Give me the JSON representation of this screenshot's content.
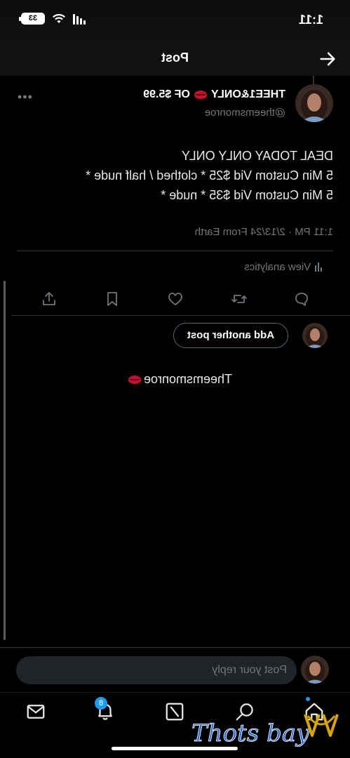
{
  "status": {
    "time": "1:11",
    "battery": "33"
  },
  "header": {
    "title": "Post"
  },
  "post": {
    "display_name": "THEE1&ONLY",
    "name_suffix": "OF $5.99",
    "handle": "@theemsmonroe",
    "body": "DEAL TODAY ONLY ONLY\n5 Min Custom Vid $25 * clothed / half nude *\n5 Min Custom Vid $35 * nude *",
    "meta": "1:11 PM · 2/13/24 From Earth",
    "analytics_label": "View analytics"
  },
  "compose": {
    "add_another_label": "Add another post",
    "signature": "Theemsmonroe"
  },
  "reply": {
    "placeholder": "Post your reply"
  },
  "tabs": {
    "notifications_badge": "8"
  },
  "watermark": {
    "text": "Thots bay"
  },
  "icons": {
    "back": "arrow-left-icon",
    "more": "more-horizontal-icon",
    "reply": "reply-icon",
    "repost": "repost-icon",
    "like": "heart-icon",
    "bookmark": "bookmark-icon",
    "share": "share-icon",
    "home": "home-icon",
    "search": "search-icon",
    "grok": "grok-icon",
    "notifications": "bell-icon",
    "messages": "mail-icon"
  },
  "colors": {
    "accent": "#1d9bf0",
    "lips": "#c8102e",
    "watermark": "#2f6ad9"
  }
}
